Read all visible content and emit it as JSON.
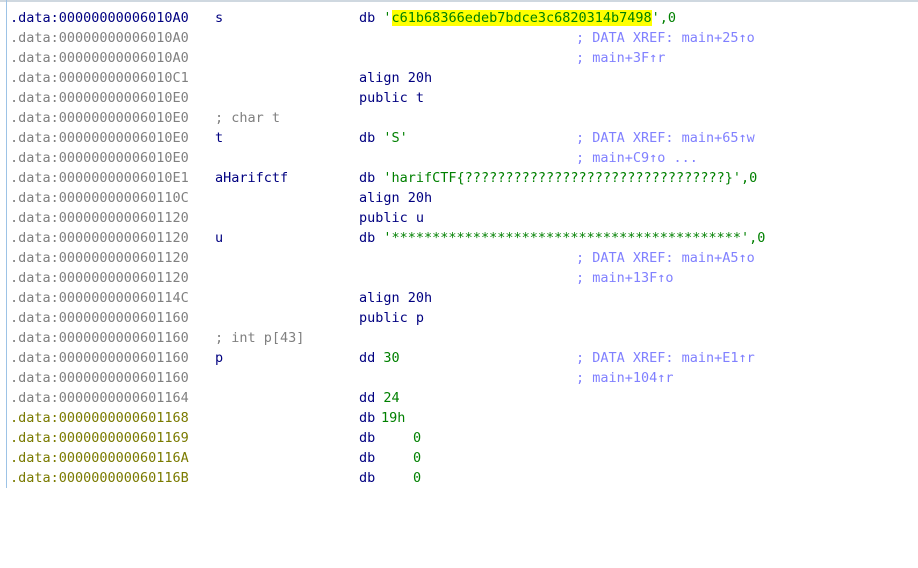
{
  "rows": [
    {
      "addr": ".data:00000000006010A0",
      "label": "s",
      "mnemonic": "db",
      "quote_open": "'",
      "highlighted_string": "c61b68366edeb7bdce3c6820314b7498",
      "quote_close": "'",
      "suffix": ",0"
    },
    {
      "addr": ".data:00000000006010A0",
      "xref": "; DATA XREF: main+25↑o"
    },
    {
      "addr": ".data:00000000006010A0",
      "xref": "; main+3F↑r"
    },
    {
      "addr": ".data:00000000006010C1",
      "instr": "align 20h"
    },
    {
      "addr": ".data:00000000006010E0",
      "instr": "public t"
    },
    {
      "addr": ".data:00000000006010E0",
      "comment": "; char t"
    },
    {
      "addr": ".data:00000000006010E0",
      "label": "t",
      "mnemonic": "db",
      "operand": "'S'",
      "xref": "; DATA XREF: main+65↑w"
    },
    {
      "addr": ".data:00000000006010E0",
      "xref": "; main+C9↑o ..."
    },
    {
      "addr": ".data:00000000006010E1",
      "label": "aHarifctf",
      "mnemonic": "db",
      "operand": "'harifCTF{????????????????????????????????}'",
      "suffix": ",0"
    },
    {
      "addr": ".data:000000000060110C",
      "instr": "align 20h"
    },
    {
      "addr": ".data:0000000000601120",
      "instr": "public u"
    },
    {
      "addr": ".data:0000000000601120",
      "label": "u",
      "mnemonic": "db",
      "operand": "'*******************************************'",
      "suffix": ",0"
    },
    {
      "addr": ".data:0000000000601120",
      "xref": "; DATA XREF: main+A5↑o"
    },
    {
      "addr": ".data:0000000000601120",
      "xref": "; main+13F↑o"
    },
    {
      "addr": ".data:000000000060114C",
      "instr": "align 20h"
    },
    {
      "addr": ".data:0000000000601160",
      "instr": "public p"
    },
    {
      "addr": ".data:0000000000601160",
      "comment": "; int p[43]"
    },
    {
      "addr": ".data:0000000000601160",
      "label": "p",
      "mnemonic": "dd",
      "operand": "30",
      "xref": "; DATA XREF: main+E1↑r"
    },
    {
      "addr": ".data:0000000000601160",
      "xref": "; main+104↑r"
    },
    {
      "addr": ".data:0000000000601164",
      "mnemonic": "dd",
      "operand": "24"
    },
    {
      "addr": ".data:0000000000601168",
      "mnemonic": "db",
      "operand": "19h"
    },
    {
      "addr": ".data:0000000000601169",
      "mnemonic": "db",
      "operand": "0"
    },
    {
      "addr": ".data:000000000060116A",
      "mnemonic": "db",
      "operand": "0"
    },
    {
      "addr": ".data:000000000060116B",
      "mnemonic": "db",
      "operand": "0"
    }
  ],
  "colors": {
    "address": "#808080",
    "address_active": "#000080",
    "address_code": "#7a7a00",
    "label": "#000080",
    "string": "#008000",
    "xref_comment": "#8080ff",
    "comment": "#808080",
    "highlight": "#ffff00"
  }
}
